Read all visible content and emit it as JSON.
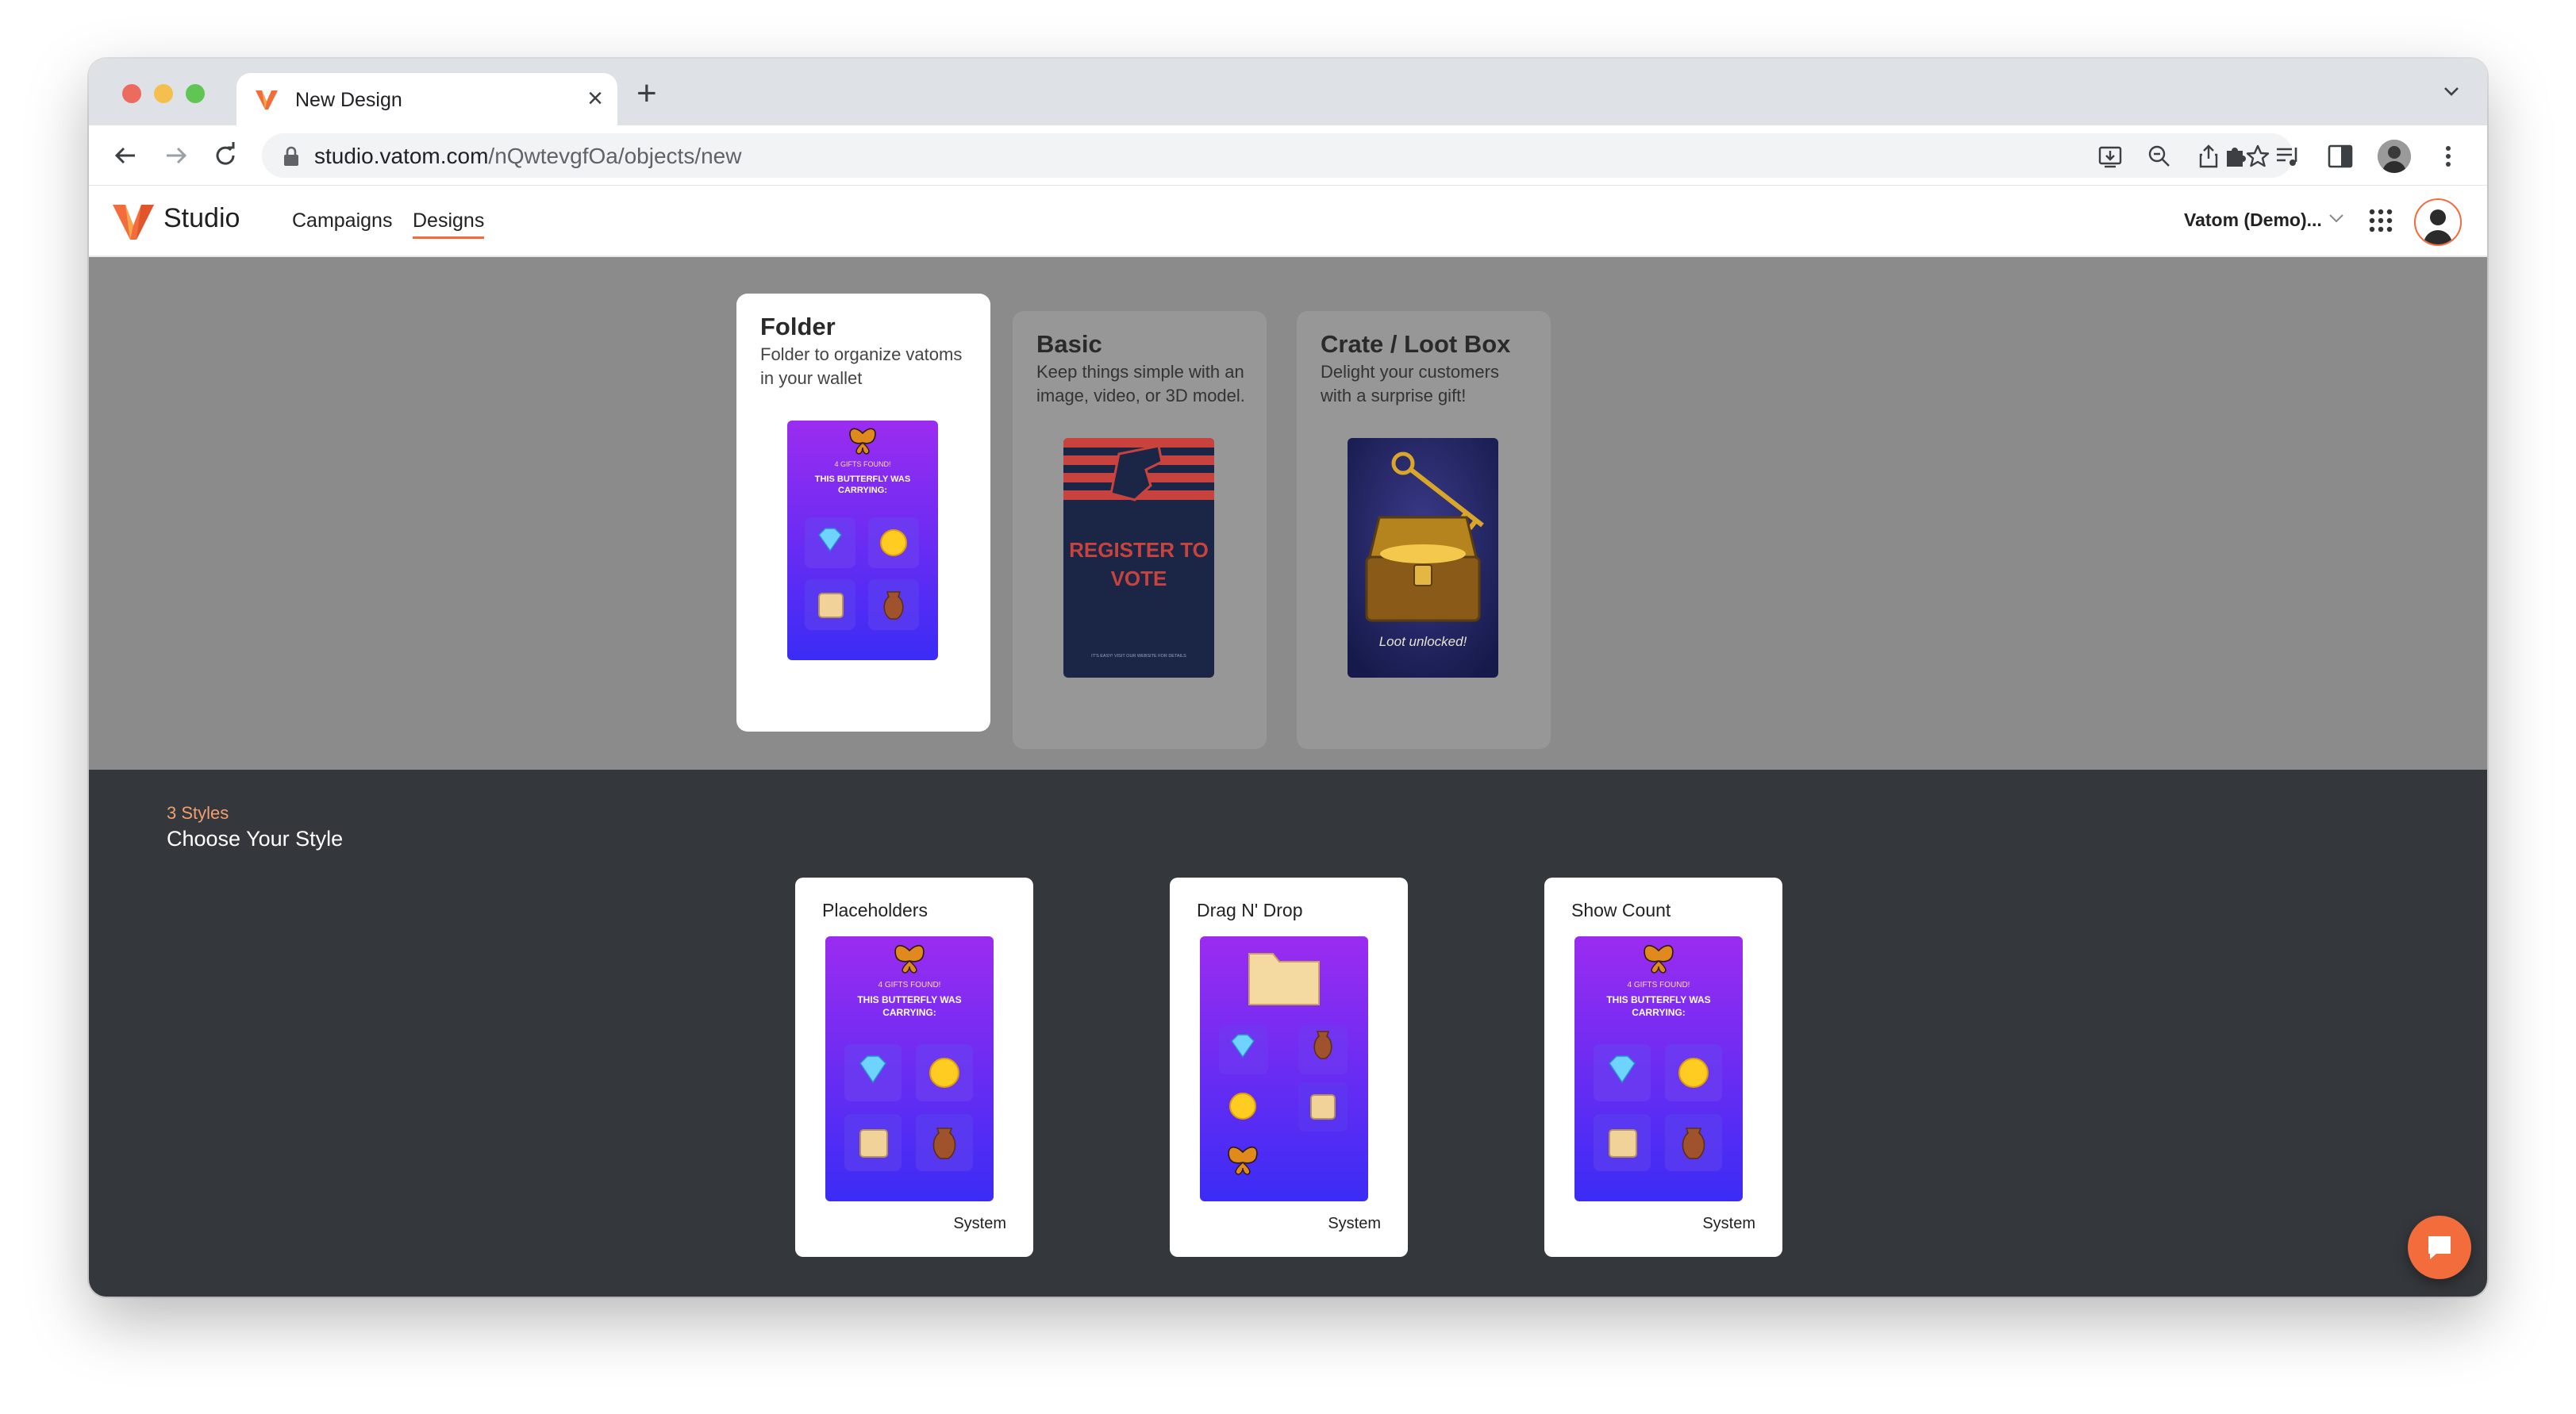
{
  "browser": {
    "tab_title": "New Design",
    "url_host": "studio.vatom.com",
    "url_path": "/nQwtevgfOa/objects/new"
  },
  "app": {
    "logo_text": "Studio",
    "nav": [
      {
        "label": "Campaigns",
        "active": false
      },
      {
        "label": "Designs",
        "active": true
      }
    ],
    "org_label": "Vatom (Demo)...",
    "accent_color": "#f26c3c"
  },
  "types": [
    {
      "title": "Folder",
      "description": "Folder to organize vatoms in your wallet",
      "selected": true
    },
    {
      "title": "Basic",
      "description": "Keep things simple with an image, video, or 3D model.",
      "selected": false
    },
    {
      "title": "Crate / Loot Box",
      "description": "Delight your customers with a surprise gift!",
      "selected": false
    }
  ],
  "thumbnails": {
    "folder_gift": {
      "count_text": "4 GIFTS FOUND!",
      "headline_1": "THIS BUTTERFLY WAS",
      "headline_2": "CARRYING:"
    },
    "basic_vote": {
      "headline_1": "REGISTER TO",
      "headline_2": "VOTE",
      "footer": "IT'S EASY! VISIT OUR WEBSITE FOR DETAILS"
    },
    "crate_loot": {
      "caption": "Loot unlocked!"
    }
  },
  "styles_section": {
    "count_label": "3 Styles",
    "title": "Choose Your Style",
    "styles": [
      {
        "name": "Placeholders",
        "source": "System"
      },
      {
        "name": "Drag N' Drop",
        "source": "System"
      },
      {
        "name": "Show Count",
        "source": "System"
      }
    ]
  }
}
